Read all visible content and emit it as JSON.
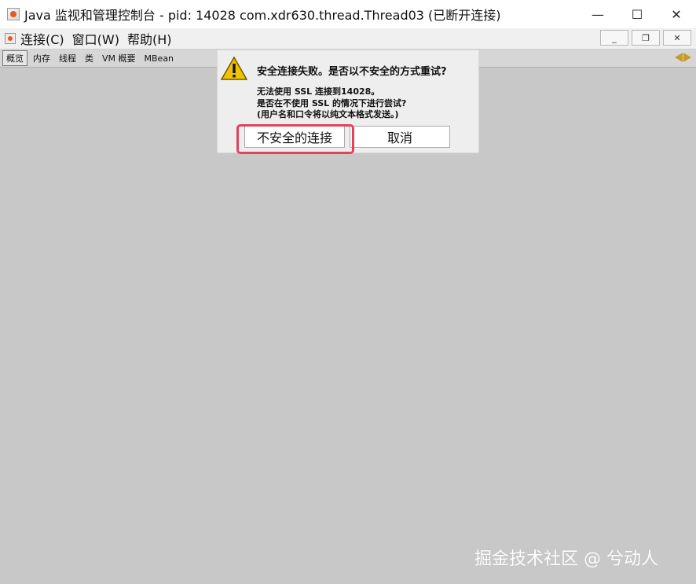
{
  "window": {
    "title": "Java 监视和管理控制台 - pid: 14028 com.xdr630.thread.Thread03 (已断开连接)",
    "controls": {
      "minimize": "—",
      "maximize": "☐",
      "close": "✕"
    }
  },
  "menubar": {
    "items": [
      "连接(C)",
      "窗口(W)",
      "帮助(H)"
    ],
    "inner_controls": {
      "minimize": "_",
      "restore": "❐",
      "close": "✕"
    }
  },
  "tabs": [
    "概览",
    "内存",
    "线程",
    "类",
    "VM 概要",
    "MBean"
  ],
  "dialog": {
    "title": "安全连接失败。是否以不安全的方式重试?",
    "lines": [
      "无法使用 SSL 连接到14028。",
      "是否在不使用 SSL 的情况下进行尝试?",
      "(用户名和口令将以纯文本格式发送。)"
    ],
    "buttons": {
      "insecure": "不安全的连接",
      "cancel": "取消"
    }
  },
  "watermark": "掘金技术社区 @ 兮动人",
  "colors": {
    "highlight": "#e0435a",
    "background": "#c8c8c8",
    "warning": "#f2c200"
  }
}
